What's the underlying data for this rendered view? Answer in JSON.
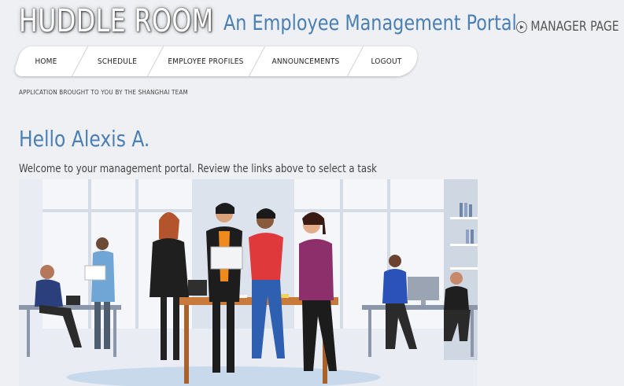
{
  "header": {
    "brand": "HUDDLE ROOM",
    "subtitle": "An Employee Management Portal",
    "manager_link": "MANAGER PAGE"
  },
  "nav": {
    "items": [
      {
        "label": "HOME"
      },
      {
        "label": "SCHEDULE"
      },
      {
        "label": "EMPLOYEE PROFILES"
      },
      {
        "label": "ANNOUNCEMENTS"
      },
      {
        "label": "LOGOUT"
      }
    ]
  },
  "credit": "APPLICATION BROUGHT TO YOU BY THE SHANGHAI TEAM",
  "main": {
    "greeting": "Hello Alexis A.",
    "welcome": "Welcome to your management portal. Review the links above to select a task"
  },
  "colors": {
    "accent": "#4a7fb5",
    "background": "#eef0f3"
  },
  "icons": {
    "manager_link_icon": "play-circle-icon"
  }
}
